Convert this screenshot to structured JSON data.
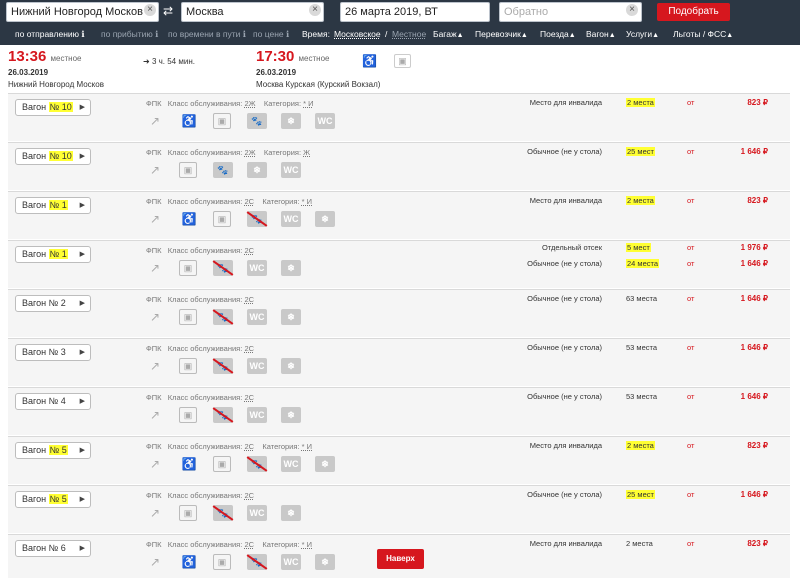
{
  "search": {
    "from_value": "Нижний Новгород Москов",
    "to_value": "Москва",
    "date_value": "26 марта 2019, ВТ",
    "return_placeholder": "Обратно",
    "submit_label": "Подобрать"
  },
  "filters": {
    "sort_departure": "по отправлению",
    "sort_arrival": "по прибытию",
    "sort_duration": "по времени в пути",
    "sort_price": "по цене",
    "time_label": "Время:",
    "time_moscow": "Московское",
    "time_sep": "/",
    "time_local": "Местное",
    "baggage": "Багаж",
    "carrier": "Перевозчик",
    "trains": "Поезда",
    "cars": "Вагон",
    "services": "Услуги",
    "benefits": "Льготы / ФСС"
  },
  "train": {
    "departure_time": "13:36",
    "departure_tag": "местное",
    "departure_date": "26.03.2019",
    "departure_station": "Нижний Новгород Москов",
    "duration": "3 ч. 54 мин.",
    "arrival_time": "17:30",
    "arrival_tag": "местное",
    "arrival_date": "26.03.2019",
    "arrival_station": "Москва Курская (Курский Вокзал)"
  },
  "labels": {
    "car_prefix": "Вагон",
    "carrier": "ФПК",
    "class_label": "Класс обслуживания:",
    "category_label": "Категория:",
    "from": "от",
    "up_button": "Наверх"
  },
  "cars": [
    {
      "num": "№ 10",
      "highlight": true,
      "class": "2Ж",
      "category": "* И",
      "icons": [
        "chart",
        "wheelchair",
        "bag",
        "pet",
        "snowflake",
        "wc"
      ],
      "seats": [
        {
          "type": "Место для инвалида",
          "count": "2 места",
          "hl": true,
          "price": "823 ₽"
        }
      ]
    },
    {
      "num": "№ 10",
      "highlight": true,
      "class": "2Ж",
      "category": "Ж",
      "icons": [
        "chart",
        "bag",
        "pet",
        "snowflake",
        "wc"
      ],
      "seats": [
        {
          "type": "Обычное (не у стола)",
          "count": "25 мест",
          "hl": true,
          "price": "1 646 ₽"
        }
      ]
    },
    {
      "num": "№ 1",
      "highlight": true,
      "class": "2С",
      "category": "* И",
      "icons": [
        "chart",
        "wheelchair",
        "bag",
        "nopet",
        "wc",
        "snowflake"
      ],
      "seats": [
        {
          "type": "Место для инвалида",
          "count": "2 места",
          "hl": true,
          "price": "823 ₽"
        }
      ]
    },
    {
      "num": "№ 1",
      "highlight": true,
      "class": "2С",
      "category": "",
      "icons": [
        "chart",
        "bag",
        "nopet",
        "wc",
        "snowflake"
      ],
      "seats": [
        {
          "type": "Отдельный отсек",
          "count": "5 мест",
          "hl": true,
          "price": "1 976 ₽"
        },
        {
          "type": "Обычное (не у стола)",
          "count": "24 места",
          "hl": true,
          "price": "1 646 ₽"
        }
      ]
    },
    {
      "num": "№ 2",
      "highlight": false,
      "class": "2С",
      "category": "",
      "icons": [
        "chart",
        "bag",
        "nopet",
        "wc",
        "snowflake"
      ],
      "seats": [
        {
          "type": "Обычное (не у стола)",
          "count": "63 места",
          "hl": false,
          "price": "1 646 ₽"
        }
      ]
    },
    {
      "num": "№ 3",
      "highlight": false,
      "class": "2С",
      "category": "",
      "icons": [
        "chart",
        "bag",
        "nopet",
        "wc",
        "snowflake"
      ],
      "seats": [
        {
          "type": "Обычное (не у стола)",
          "count": "53 места",
          "hl": false,
          "price": "1 646 ₽"
        }
      ]
    },
    {
      "num": "№ 4",
      "highlight": false,
      "class": "2С",
      "category": "",
      "icons": [
        "chart",
        "bag",
        "nopet",
        "wc",
        "snowflake"
      ],
      "seats": [
        {
          "type": "Обычное (не у стола)",
          "count": "53 места",
          "hl": false,
          "price": "1 646 ₽"
        }
      ]
    },
    {
      "num": "№ 5",
      "highlight": true,
      "class": "2С",
      "category": "* И",
      "icons": [
        "chart",
        "wheelchair",
        "bag",
        "nopet",
        "wc",
        "snowflake"
      ],
      "seats": [
        {
          "type": "Место для инвалида",
          "count": "2 места",
          "hl": true,
          "price": "823 ₽"
        }
      ]
    },
    {
      "num": "№ 5",
      "highlight": true,
      "class": "2С",
      "category": "",
      "icons": [
        "chart",
        "bag",
        "nopet",
        "wc",
        "snowflake"
      ],
      "seats": [
        {
          "type": "Обычное (не у стола)",
          "count": "25 мест",
          "hl": true,
          "price": "1 646 ₽"
        }
      ]
    },
    {
      "num": "№ 6",
      "highlight": false,
      "class": "2С",
      "category": "* И",
      "icons": [
        "chart",
        "wheelchair",
        "bag",
        "nopet",
        "wc",
        "snowflake"
      ],
      "seats": [
        {
          "type": "Место для инвалида",
          "count": "2 места",
          "hl": false,
          "price": "823 ₽"
        }
      ]
    }
  ],
  "colors": {
    "accent": "#d6171e",
    "topbar": "#2c3744",
    "highlight": "#ffff33"
  }
}
